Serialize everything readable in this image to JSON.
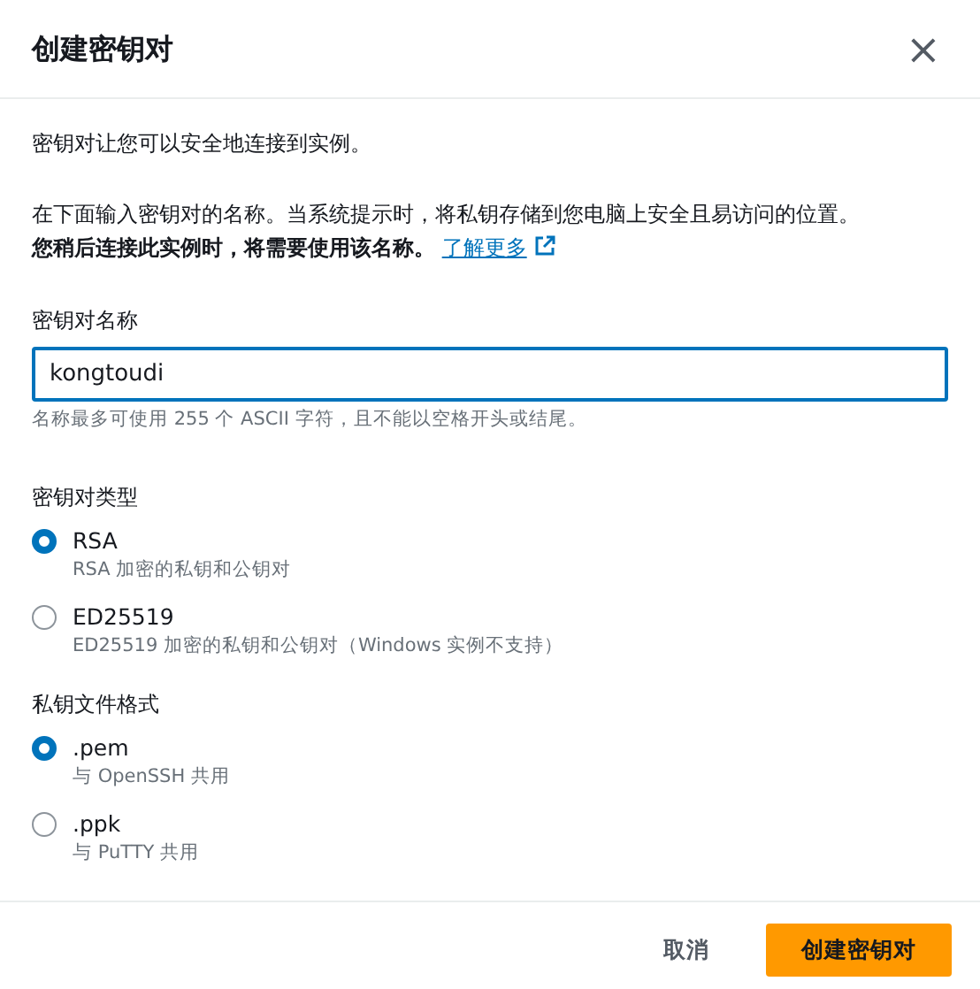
{
  "dialog": {
    "title": "创建密钥对",
    "close": "×"
  },
  "intro": "密钥对让您可以安全地连接到实例。",
  "description": {
    "text": "在下面输入密钥对的名称。当系统提示时，将私钥存储到您电脑上安全且易访问的位置。**您稍后连接此实例时，将需要使用该名称。**",
    "link": "了解更多"
  },
  "name_field": {
    "label": "密钥对名称",
    "value": "kongtoudi",
    "hint": "名称最多可使用 255 个 ASCII 字符，且不能以空格开头或结尾。"
  },
  "groups": [
    {
      "label": "密钥对类型",
      "options": [
        {
          "label": "RSA",
          "description": "RSA 加密的私钥和公钥对",
          "selected": true
        },
        {
          "label": "ED25519",
          "description": "ED25519 加密的私钥和公钥对（Windows 实例不支持）",
          "selected": false
        }
      ]
    },
    {
      "label": "私钥文件格式",
      "options": [
        {
          "label": ".pem",
          "description": "与 OpenSSH 共用",
          "selected": true
        },
        {
          "label": ".ppk",
          "description": "与 PuTTY 共用",
          "selected": false
        }
      ]
    }
  ],
  "buttons": {
    "cancel": "取消",
    "submit": "创建密钥对"
  }
}
